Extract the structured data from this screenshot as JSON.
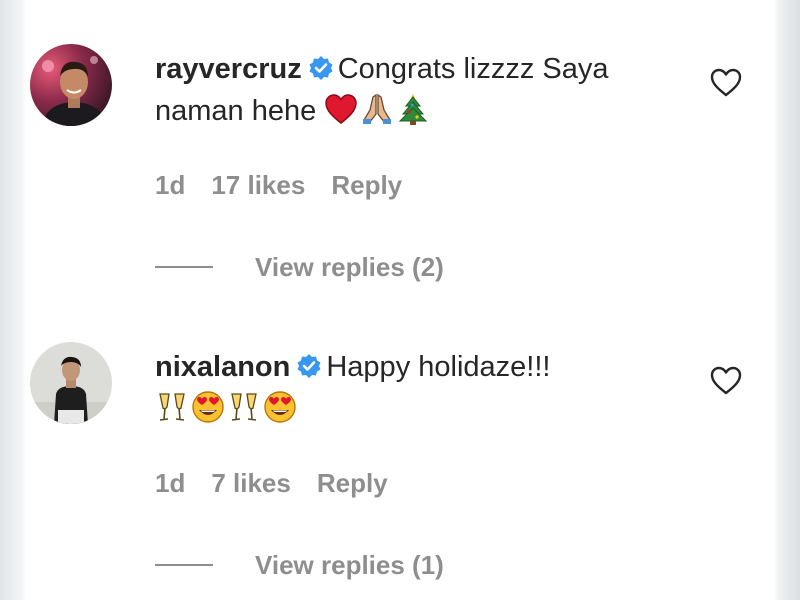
{
  "comments": [
    {
      "username": "rayvercruz",
      "text": "Congrats lizzzz Saya naman hehe",
      "emojis": [
        "red-heart",
        "folded-hands",
        "christmas-tree"
      ],
      "time": "1d",
      "likes": "17 likes",
      "reply": "Reply",
      "view_replies": "View replies (2)"
    },
    {
      "username": "nixalanon",
      "text": "Happy holidaze!!!",
      "emojis": [
        "clinking-glasses",
        "heart-eyes",
        "clinking-glasses",
        "heart-eyes"
      ],
      "time": "1d",
      "likes": "7 likes",
      "reply": "Reply",
      "view_replies": "View replies (1)"
    }
  ],
  "colors": {
    "text": "#262626",
    "muted": "#8e8e8e",
    "verified": "#3897f0",
    "heart": "#e0182d"
  }
}
